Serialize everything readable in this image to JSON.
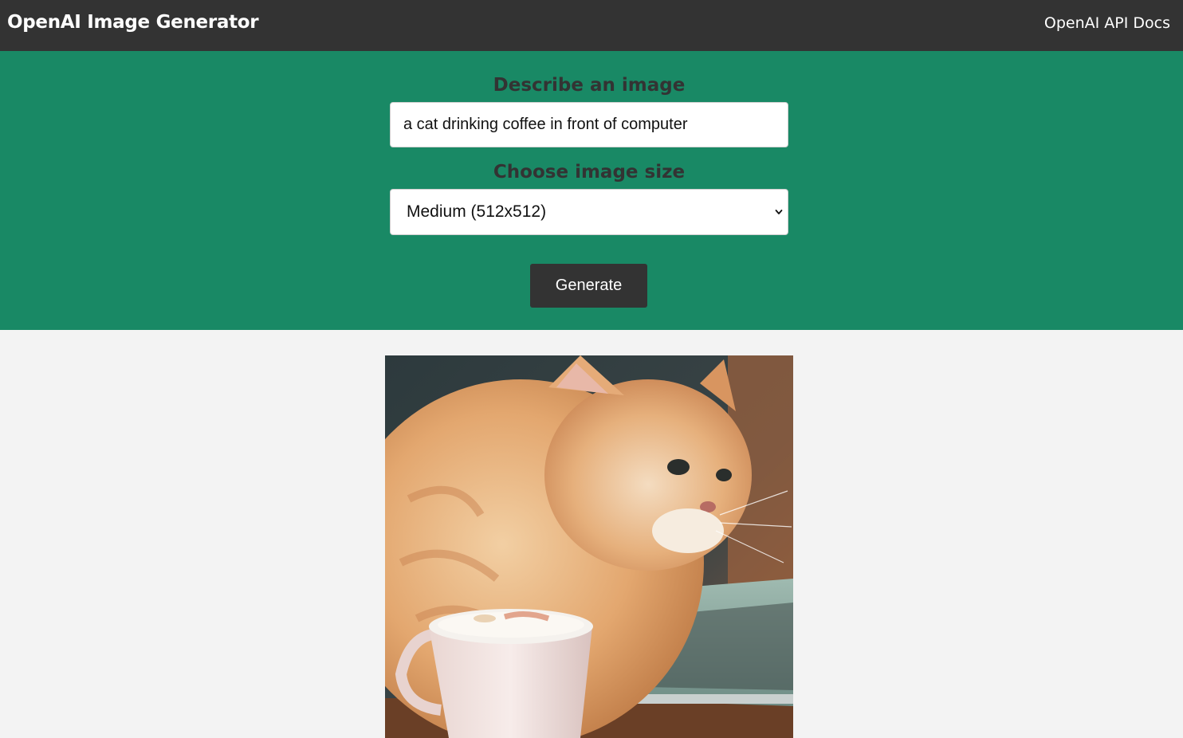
{
  "navbar": {
    "title": "OpenAI Image Generator",
    "docs_link": "OpenAI API Docs"
  },
  "form": {
    "prompt_label": "Describe an image",
    "prompt_value": "a cat drinking coffee in front of computer",
    "size_label": "Choose image size",
    "size_selected": "Medium (512x512)",
    "generate_label": "Generate"
  },
  "colors": {
    "navbar_bg": "#333333",
    "showcase_bg": "#198965",
    "page_bg": "#f3f3f3"
  }
}
